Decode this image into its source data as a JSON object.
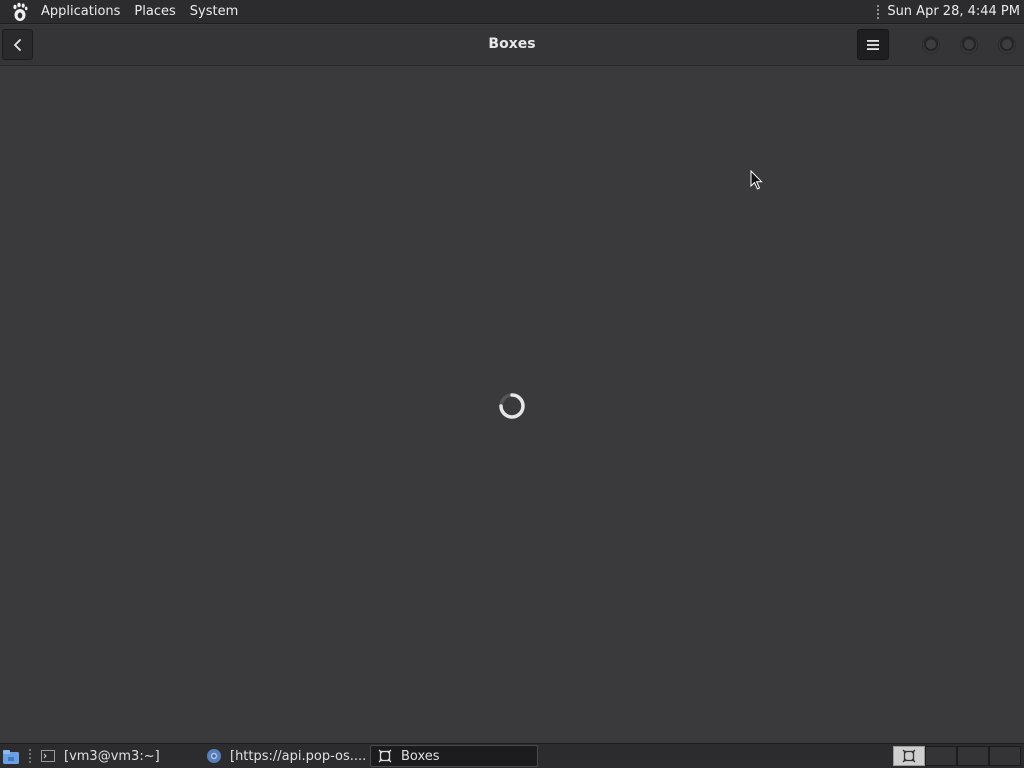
{
  "top_panel": {
    "menus": [
      "Applications",
      "Places",
      "System"
    ],
    "clock": "Sun Apr 28,  4:44 PM",
    "logo_icon": "gnome-foot-icon"
  },
  "window": {
    "title": "Boxes",
    "back_icon": "chevron-left-icon",
    "menu_icon": "hamburger-menu-icon",
    "window_controls": [
      "minimize",
      "maximize",
      "close"
    ]
  },
  "content": {
    "state": "loading",
    "spinner_icon": "loading-spinner-icon"
  },
  "taskbar": {
    "tasks": [
      {
        "label": "[vm3@vm3:~]",
        "icon": "terminal-icon",
        "active": false
      },
      {
        "label": "[https://api.pop-os....",
        "icon": "browser-icon",
        "active": false
      },
      {
        "label": "Boxes",
        "icon": "boxes-icon",
        "active": true
      }
    ],
    "workspaces": 4,
    "active_workspace": 1
  },
  "colors": {
    "panel_bg": "#2c2c2e",
    "window_bg": "#3a3a3d",
    "headerbar_bg": "#353538",
    "text": "#e6e6e6"
  }
}
